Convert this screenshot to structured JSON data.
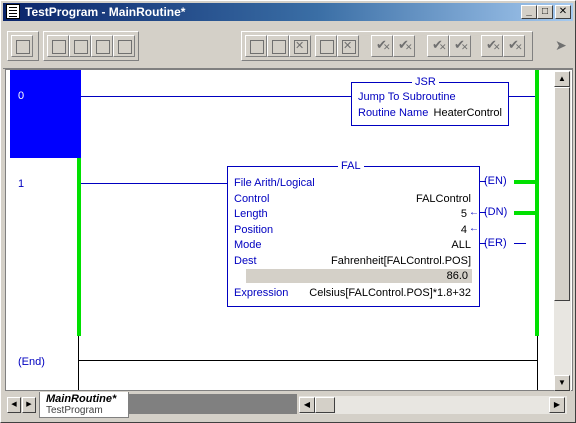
{
  "window": {
    "title": "TestProgram - MainRoutine*",
    "controls": {
      "minimize": "_",
      "maximize": "□",
      "close": "✕"
    }
  },
  "toolbar": {
    "buttons": [
      "rung-icon",
      "branch-icon",
      "branch-level-icon",
      "branch-remove-icon",
      "branch-insert-icon",
      "xic-icon",
      "xio-icon",
      "ons-icon",
      "ote-icon",
      "otl-icon",
      "otu-icon",
      "verify-icon",
      "verify-cancel-icon",
      "verify-all-icon",
      "verify-all-cancel-icon",
      "accept-icon",
      "reject-icon",
      "more-arrow-icon"
    ]
  },
  "ladder": {
    "rungs": [
      {
        "number": "0",
        "instruction": {
          "mnemonic": "JSR",
          "name": "Jump To Subroutine",
          "fields": [
            {
              "label": "Routine Name",
              "value": "HeaterControl"
            }
          ]
        }
      },
      {
        "number": "1",
        "instruction": {
          "mnemonic": "FAL",
          "name": "File Arith/Logical",
          "fields": [
            {
              "label": "Control",
              "value": "FALControl"
            },
            {
              "label": "Length",
              "value": "5"
            },
            {
              "label": "Position",
              "value": "4"
            },
            {
              "label": "Mode",
              "value": "ALL"
            },
            {
              "label": "Dest",
              "value": "Fahrenheit[FALControl.POS]"
            },
            {
              "label": "Expression",
              "value": "Celsius[FALControl.POS]*1.8+32"
            }
          ],
          "dest_value": "86.0",
          "outputs": [
            "EN",
            "DN",
            "ER"
          ]
        }
      }
    ],
    "end_label": "(End)"
  },
  "tabs": {
    "routine": "MainRoutine*",
    "program": "TestProgram"
  },
  "colors": {
    "selection": "#0000ff",
    "wire": "#0000c0",
    "power_rail": "#00e000",
    "title_bar": "#0a246a"
  }
}
